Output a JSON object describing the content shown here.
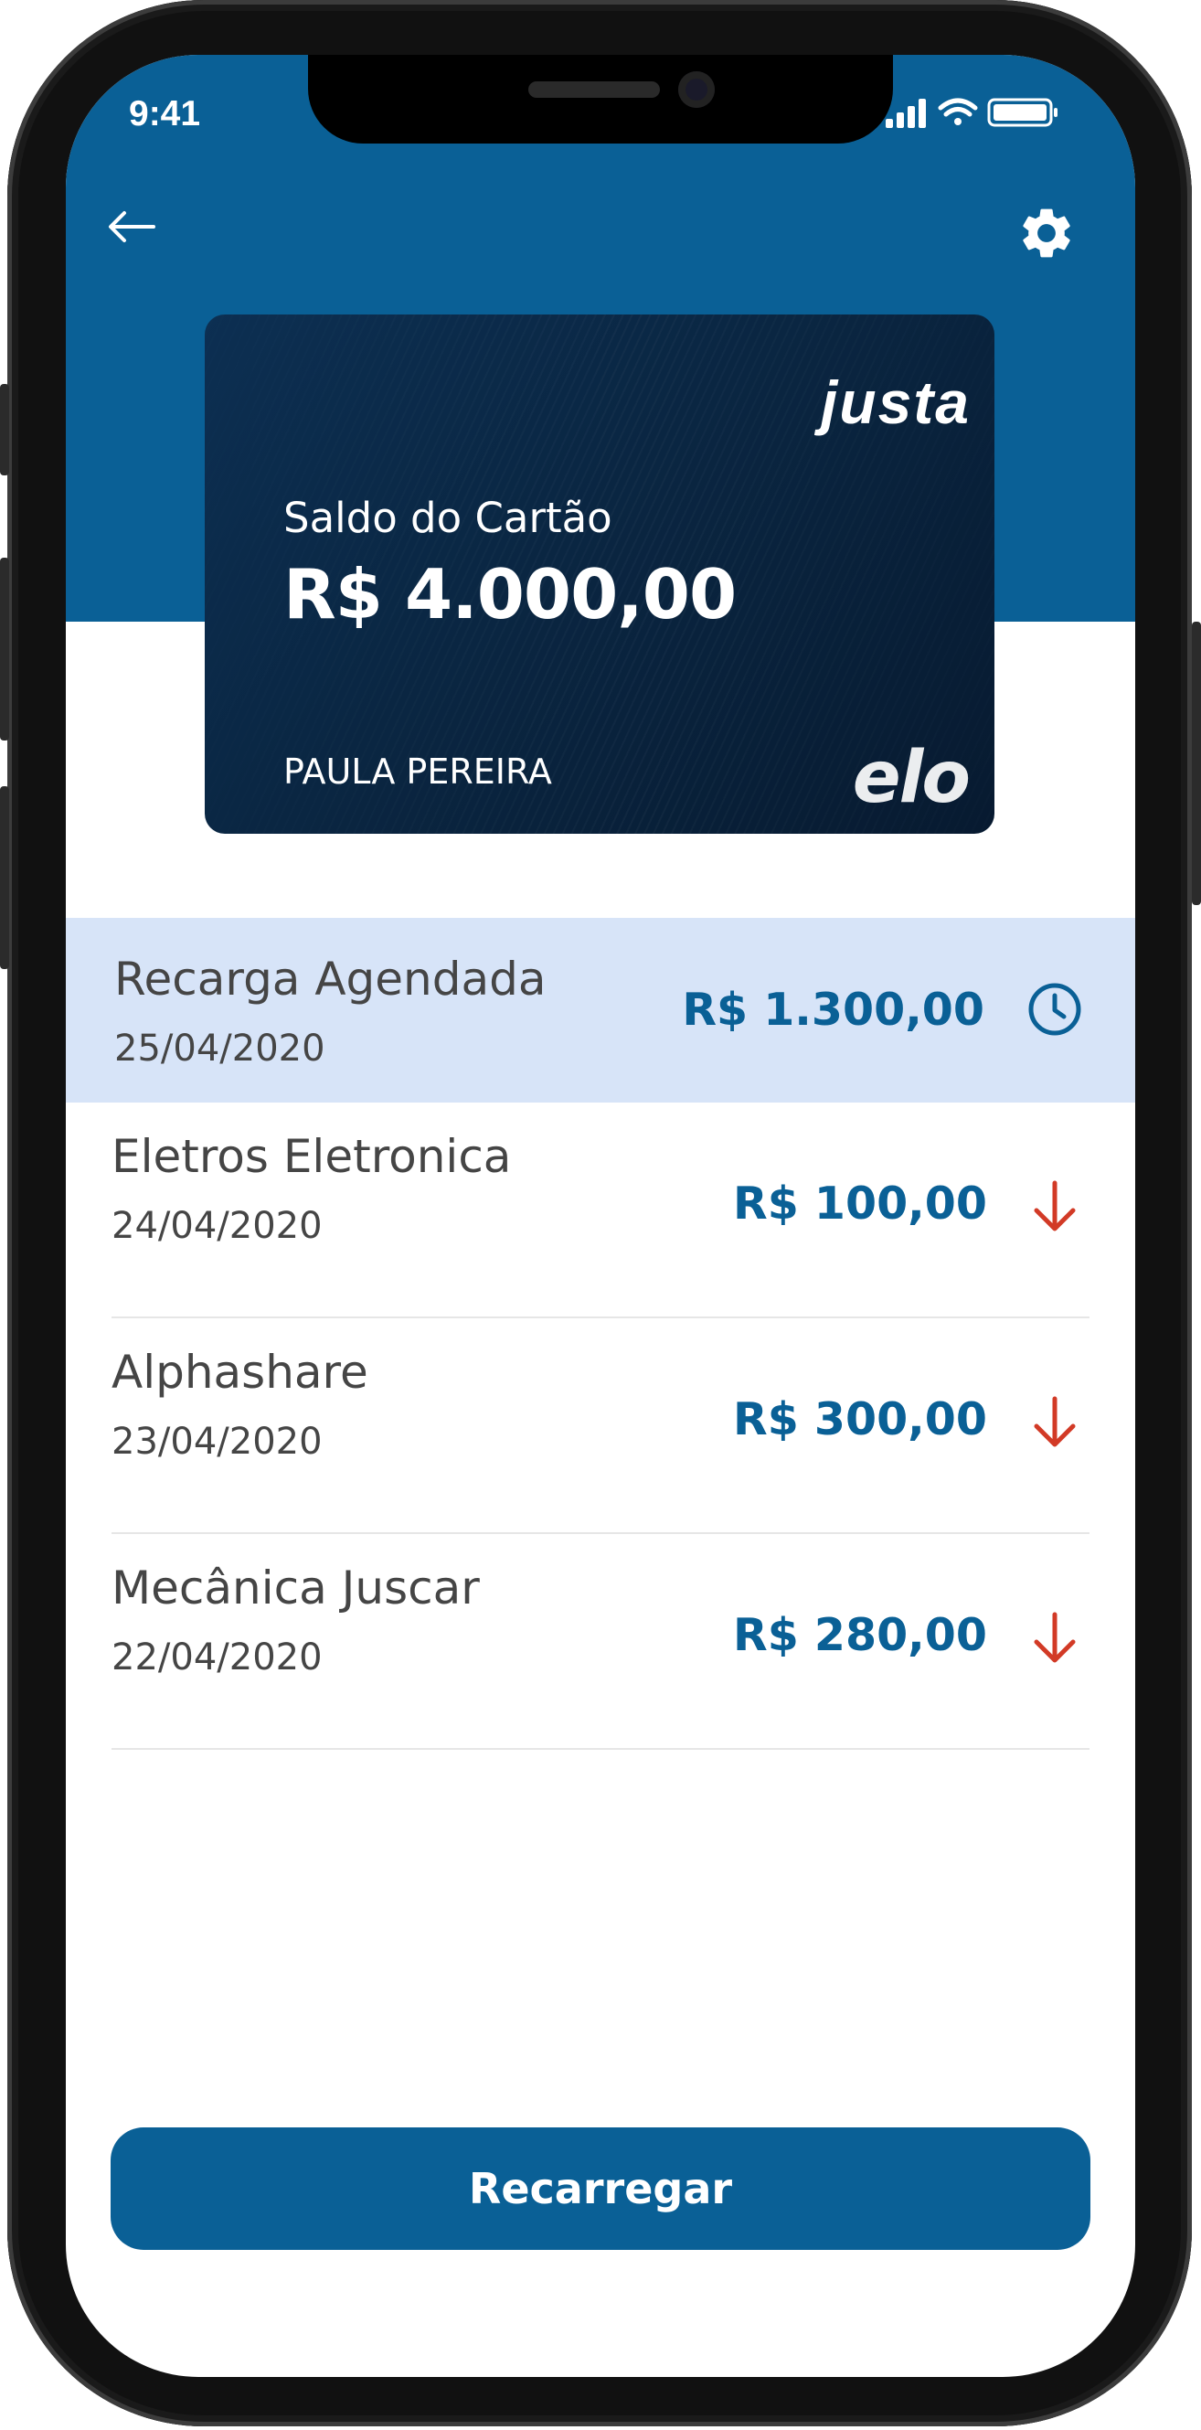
{
  "status_bar": {
    "time": "9:41"
  },
  "header": {
    "back_icon": "arrow-left-icon",
    "settings_icon": "gear-icon"
  },
  "card": {
    "brand": "justa",
    "balance_label": "Saldo do Cartão",
    "balance_value": "R$ 4.000,00",
    "holder": "PAULA PEREIRA",
    "network": "elo"
  },
  "transactions": [
    {
      "name": "Recarga Agendada",
      "date": "25/04/2020",
      "amount": "R$ 1.300,00",
      "icon": "clock-icon"
    },
    {
      "name": "Eletros Eletronica",
      "date": "24/04/2020",
      "amount": "R$ 100,00",
      "icon": "arrow-down-icon"
    },
    {
      "name": "Alphashare",
      "date": "23/04/2020",
      "amount": "R$ 300,00",
      "icon": "arrow-down-icon"
    },
    {
      "name": "Mecânica Juscar",
      "date": "22/04/2020",
      "amount": "R$ 280,00",
      "icon": "arrow-down-icon"
    }
  ],
  "actions": {
    "recharge_label": "Recarregar"
  },
  "colors": {
    "primary": "#0a6096",
    "highlight_row": "#d7e4f8",
    "debit_arrow": "#d23a26",
    "card_bg": "#0a2642"
  }
}
